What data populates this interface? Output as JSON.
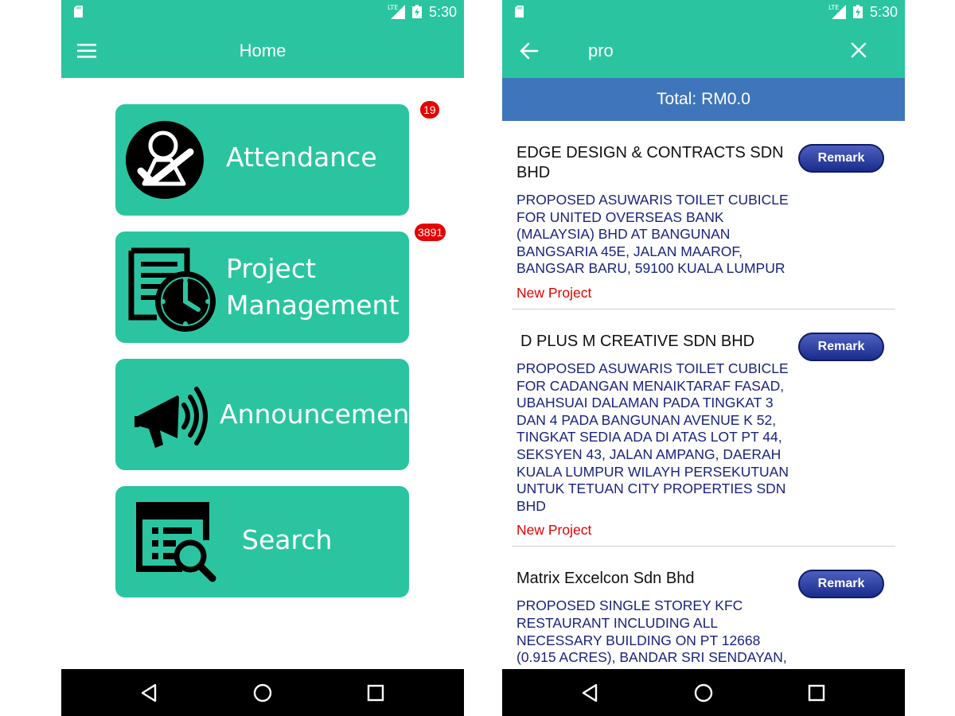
{
  "status_bar": {
    "time": "5:30",
    "network": "LTE"
  },
  "home": {
    "title": "Home",
    "tiles": [
      {
        "label": "Attendance",
        "icon": "attendance-icon",
        "badge": "19"
      },
      {
        "label_lines": [
          "Project",
          "Management"
        ],
        "icon": "project-management-icon",
        "badge": "3891"
      },
      {
        "label": "Announcement",
        "icon": "megaphone-icon"
      },
      {
        "label": "Search",
        "icon": "search-list-icon"
      }
    ]
  },
  "search": {
    "query": "pro",
    "total": "Total: RM0.0",
    "remark_label": "Remark",
    "results": [
      {
        "company": "EDGE DESIGN & CONTRACTS SDN BHD",
        "description": "PROPOSED ASUWARIS TOILET CUBICLE FOR UNITED OVERSEAS BANK (MALAYSIA) BHD AT BANGUNAN BANGSARIA 45E, JALAN MAAROF, BANGSAR BARU, 59100 KUALA LUMPUR",
        "status": "New Project"
      },
      {
        "company": "D PLUS M CREATIVE SDN BHD",
        "description": "PROPOSED ASUWARIS TOILET CUBICLE FOR CADANGAN MENAIKTARAF FASAD, UBAHSUAI DALAMAN PADA TINGKAT 3 DAN 4 PADA BANGUNAN AVENUE K 52, TINGKAT SEDIA ADA DI ATAS LOT PT 44, SEKSYEN 43, JALAN AMPANG, DAERAH KUALA LUMPUR WILAYH PERSEKUTUAN UNTUK TETUAN CITY PROPERTIES SDN BHD",
        "status": "New Project"
      },
      {
        "company": "Matrix Excelcon Sdn Bhd",
        "description": "PROPOSED SINGLE STOREY KFC RESTAURANT INCLUDING ALL NECESSARY BUILDING ON PT 12668 (0.915 ACRES), BANDAR SRI SENDAYAN, ADAERAH SEREMBAN, NEGERI SEMBILAN DARUL",
        "status": ""
      }
    ]
  },
  "colors": {
    "teal": "#2ac5a0",
    "blue_bar": "#3f75bb",
    "badge": "#e60000",
    "navy_text": "#1a237e",
    "status_red": "#e00000"
  }
}
